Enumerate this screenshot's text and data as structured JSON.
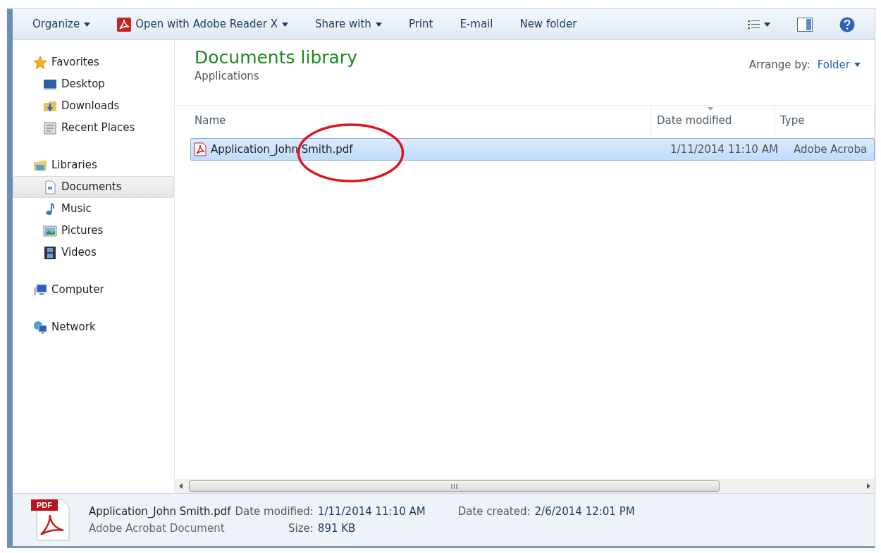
{
  "toolbar": {
    "items": [
      {
        "label": "Organize",
        "kind": "menu"
      },
      {
        "label": "Open with Adobe Reader X",
        "kind": "app-menu"
      },
      {
        "label": "Share with",
        "kind": "menu"
      },
      {
        "label": "Print",
        "kind": "button"
      },
      {
        "label": "E-mail",
        "kind": "button"
      },
      {
        "label": "New folder",
        "kind": "button"
      }
    ]
  },
  "sidebar": {
    "groups": [
      {
        "label": "Favorites",
        "kind": "favorites",
        "selected": false,
        "children": [
          {
            "label": "Desktop",
            "kind": "desktop",
            "selected": false
          },
          {
            "label": "Downloads",
            "kind": "downloads",
            "selected": false
          },
          {
            "label": "Recent Places",
            "kind": "recent",
            "selected": false
          }
        ]
      },
      {
        "label": "Libraries",
        "kind": "libraries",
        "selected": false,
        "children": [
          {
            "label": "Documents",
            "kind": "documents",
            "selected": true
          },
          {
            "label": "Music",
            "kind": "music",
            "selected": false
          },
          {
            "label": "Pictures",
            "kind": "pictures",
            "selected": false
          },
          {
            "label": "Videos",
            "kind": "videos",
            "selected": false
          }
        ]
      },
      {
        "label": "Computer",
        "kind": "computer",
        "selected": false
      },
      {
        "label": "Network",
        "kind": "network",
        "selected": false
      }
    ]
  },
  "library": {
    "title": "Documents library",
    "subtitle": "Applications",
    "arrange_label": "Arrange by:",
    "arrange_value": "Folder"
  },
  "table": {
    "columns": [
      {
        "label": "Name",
        "sorted": false
      },
      {
        "label": "Date modified",
        "sorted": true
      },
      {
        "label": "Type",
        "sorted": false
      }
    ],
    "rows": [
      {
        "name": "Application_John Smith.pdf",
        "date_modified": "1/11/2014 11:10 AM",
        "type": "Adobe Acroba",
        "selected": true,
        "circled": true
      }
    ]
  },
  "details": {
    "name": "Application_John Smith.pdf",
    "file_type": "Adobe Acrobat Document",
    "icon_label": "PDF",
    "fields": [
      {
        "label": "Date modified:",
        "value": "1/11/2014 11:10 AM"
      },
      {
        "label": "Date created:",
        "value": "2/6/2014 12:01 PM"
      },
      {
        "label": "Size:",
        "value": "891 KB"
      }
    ]
  }
}
